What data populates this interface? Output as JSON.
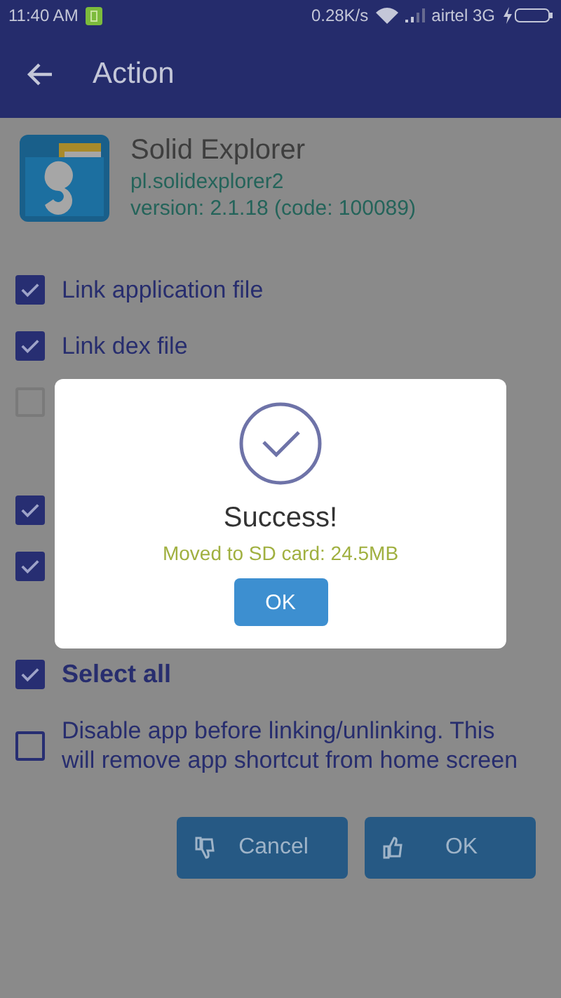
{
  "status_bar": {
    "time": "11:40 AM",
    "speed": "0.28K/s",
    "carrier": "airtel 3G"
  },
  "toolbar": {
    "title": "Action"
  },
  "app": {
    "name": "Solid Explorer",
    "package": "pl.solidexplorer2",
    "version": "version: 2.1.18 (code: 100089)"
  },
  "options": [
    {
      "label": "Link application file",
      "checked": true
    },
    {
      "label": "Link dex file",
      "checked": true
    },
    {
      "checked": false
    },
    {
      "checked": true
    },
    {
      "checked": true
    }
  ],
  "select_all": {
    "label": "Select all",
    "checked": true
  },
  "disable_option": {
    "label": "Disable app before linking/unlinking. This will remove app shortcut from home screen",
    "checked": false
  },
  "buttons": [
    {
      "kind": "cancel",
      "label": "Cancel"
    },
    {
      "kind": "ok",
      "label": "OK"
    }
  ],
  "dialog": {
    "title": "Success!",
    "message": "Moved to SD card: 24.5MB",
    "button": "OK"
  }
}
